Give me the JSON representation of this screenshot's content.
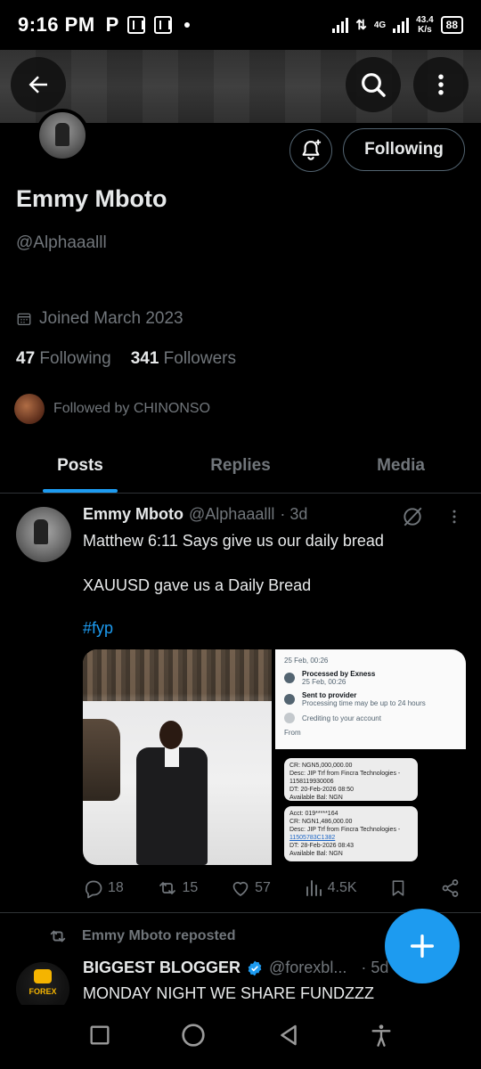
{
  "status_bar": {
    "time": "9:16 PM",
    "left_icon_letter": "P",
    "network_type": "4G",
    "speed_value": "43.4",
    "speed_unit": "K/s",
    "battery": "88"
  },
  "profile": {
    "name": "Emmy Mboto",
    "handle": "@Alphaaalll",
    "joined": "Joined March 2023",
    "following_count": "47",
    "following_label": "Following",
    "followers_count": "341",
    "followers_label": "Followers",
    "followed_by": "Followed by CHINONSO",
    "following_button": "Following"
  },
  "tabs": [
    "Posts",
    "Replies",
    "Media"
  ],
  "tweet": {
    "name": "Emmy Mboto",
    "handle": "@Alphaaalll",
    "time": "· 3d",
    "line1": "Matthew 6:11 Says give us our daily bread",
    "line2": "XAUUSD gave us a Daily Bread",
    "hashtag": "#fyp",
    "media_text": {
      "row1": "25 Feb, 00:26",
      "row2_title": "Processed by Exness",
      "row2_sub": "25 Feb, 00:26",
      "row3_title": "Sent to provider",
      "row3_sub": "Processing time may be up to 24 hours",
      "row4_title": "Crediting to your account",
      "from_label": "From",
      "bubble1": "CR: NGN5,000,000.00\nDesc: JIP Trf from Fincra Technologies - 1158119930006\nDT: 20-Feb-2026 08:50\nAvailable Bal: NGN",
      "bubble2_acct": "Acct: 019*****164",
      "bubble2_cr": "CR: NGN1,486,000.00",
      "bubble2_desc": "Desc: JIP Trf from Fincra Technologies -",
      "bubble2_ref": "11505783C1382",
      "bubble2_dt": "DT: 28-Feb-2026 08:43",
      "bubble2_bal": "Available Bal: NGN"
    },
    "replies": "18",
    "reposts": "15",
    "likes": "57",
    "views": "4.5K"
  },
  "repost_line": "Emmy Mboto reposted",
  "tweet2": {
    "name": "BIGGEST BLOGGER",
    "handle": "@forexbl...",
    "time": "· 5d",
    "text": "MONDAY NIGHT WE SHARE FUNDZZZ",
    "avatar_logo": "FOREX"
  },
  "colors": {
    "accent": "#1d9bf0",
    "muted": "#71767b",
    "text": "#e7e9ea",
    "divider": "#2f3336"
  },
  "icons": [
    "back-arrow-icon",
    "search-icon",
    "more-vertical-icon",
    "bell-plus-icon",
    "calendar-icon",
    "grok-icon",
    "reply-icon",
    "repost-icon",
    "like-icon",
    "views-icon",
    "bookmark-icon",
    "share-icon",
    "verified-icon",
    "compose-plus-icon",
    "recents-icon",
    "home-icon",
    "back-triangle-icon",
    "accessibility-icon"
  ]
}
